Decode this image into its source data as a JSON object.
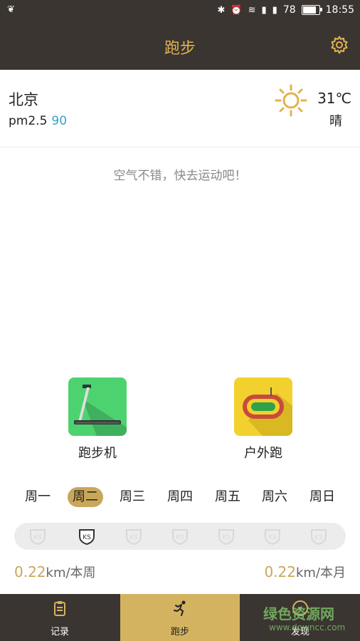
{
  "status_bar": {
    "battery": "78",
    "time": "18:55"
  },
  "header": {
    "title": "跑步"
  },
  "weather": {
    "city": "北京",
    "pm_label": "pm2.5",
    "pm_value": "90",
    "temperature": "31℃",
    "condition": "晴"
  },
  "tip": "空气不错，快去运动吧！",
  "modes": [
    {
      "label": "跑步机"
    },
    {
      "label": "户外跑"
    }
  ],
  "weekdays": [
    "周一",
    "周二",
    "周三",
    "周四",
    "周五",
    "周六",
    "周日"
  ],
  "active_day_index": 1,
  "stats": {
    "week_value": "0.22",
    "week_unit": "km/本周",
    "month_value": "0.22",
    "month_unit": "km/本月"
  },
  "tabs": [
    {
      "label": "记录"
    },
    {
      "label": "跑步"
    },
    {
      "label": "发现"
    }
  ],
  "watermark": {
    "text": "绿色资源网",
    "url": "www.downcc.com"
  },
  "colors": {
    "accent": "#c9a75a",
    "dark": "#3a3530",
    "title": "#e2b24f",
    "pm": "#3aa0c8"
  }
}
